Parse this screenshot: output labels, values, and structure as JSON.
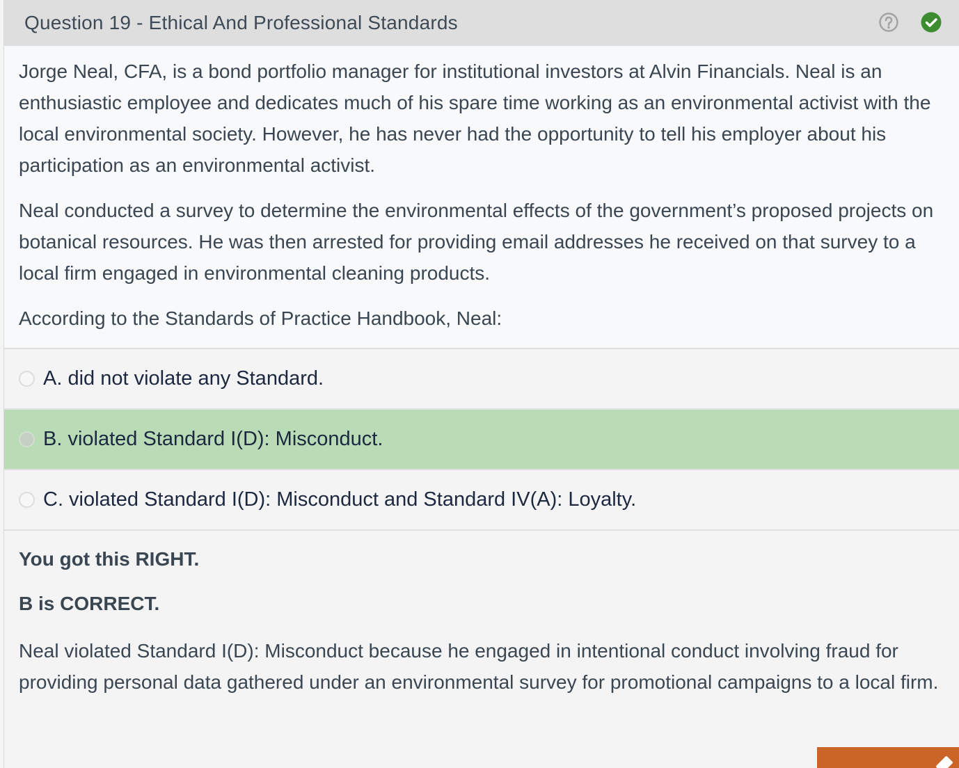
{
  "header": {
    "title": "Question 19 - Ethical And Professional Standards",
    "help_icon": "question-circle-icon",
    "status_icon": "check-circle-icon",
    "status_color": "#3d8c2f"
  },
  "question": {
    "paragraphs": [
      "Jorge Neal, CFA, is a bond portfolio manager for institutional investors at Alvin Financials. Neal is an enthusiastic employee and dedicates much of his spare time working as an environmental activist with the local environmental society.  However, he has never had the opportunity to tell his employer about his participation as an environmental activist.",
      "Neal conducted a survey to determine the environmental effects of the government’s proposed projects on botanical resources.  He was then arrested for providing email addresses he received on that survey to a local firm engaged in environmental cleaning products.",
      "According to the Standards of Practice Handbook, Neal:"
    ]
  },
  "options": [
    {
      "label": "A. did not violate any Standard.",
      "selected": false
    },
    {
      "label": "B. violated Standard I(D): Misconduct.",
      "selected": true
    },
    {
      "label": "C. violated Standard I(D): Misconduct and Standard IV(A): Loyalty.",
      "selected": false
    }
  ],
  "explanation": {
    "result": "You got this RIGHT.",
    "correct": "B is CORRECT.",
    "text": "Neal violated Standard I(D): Misconduct because he engaged in intentional conduct involving fraud for providing personal data gathered under an environmental survey for promotional campaigns to a local firm."
  },
  "colors": {
    "selected_option": "#b9dbb5",
    "action_button": "#cb6527"
  }
}
